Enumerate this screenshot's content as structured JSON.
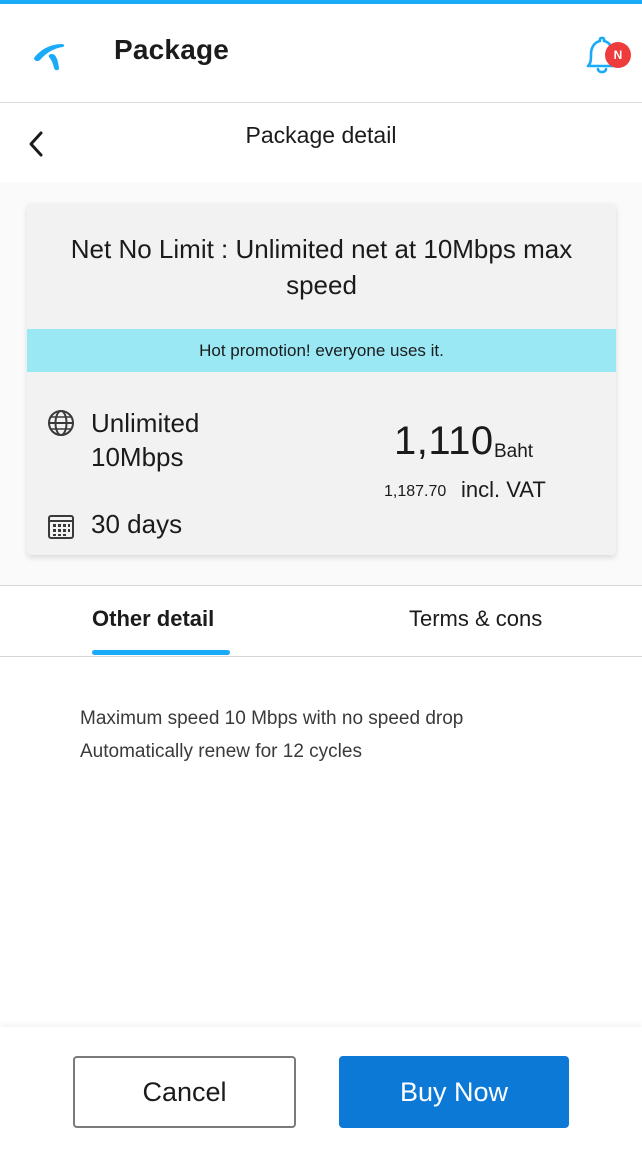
{
  "header": {
    "title": "Package",
    "logo_icon": "telenor-logo-icon",
    "notification_badge": "N",
    "accent_color": "#19aaf8"
  },
  "subheader": {
    "title": "Package detail",
    "back_icon": "chevron-left-icon"
  },
  "package": {
    "name": "Net No Limit : Unlimited net at 10Mbps max speed",
    "promotion": "Hot promotion! everyone uses it.",
    "data_allowance": "Unlimited 10Mbps",
    "validity": "30 days",
    "price": "1,110",
    "currency": "Baht",
    "price_incl_vat": "1,187.70",
    "vat_label": "incl. VAT"
  },
  "tabs": [
    {
      "label": "Other detail",
      "active": true
    },
    {
      "label": "Terms & cons",
      "active": false
    }
  ],
  "details": {
    "lines": [
      "Maximum speed 10 Mbps with no speed drop",
      "Automatically renew for 12 cycles"
    ]
  },
  "actions": {
    "cancel_label": "Cancel",
    "buy_label": "Buy Now",
    "buy_color": "#0c79d7"
  }
}
